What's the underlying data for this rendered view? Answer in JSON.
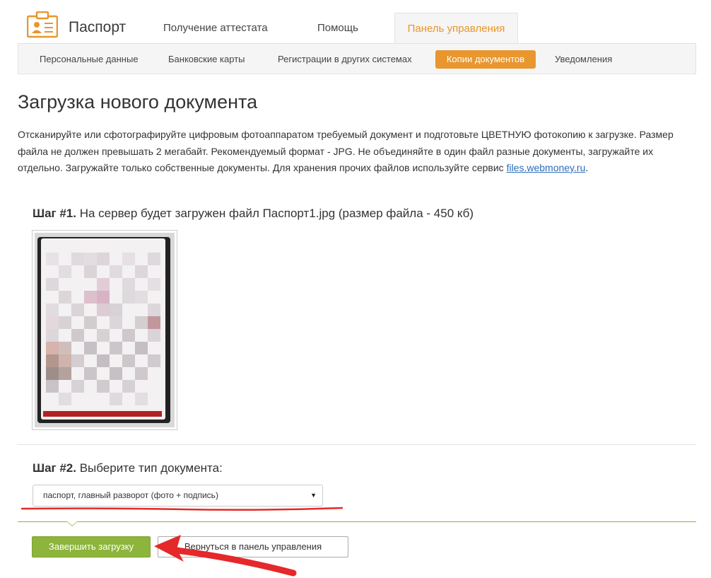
{
  "header": {
    "brand": "Паспорт",
    "tabs": [
      {
        "label": "Получение аттестата"
      },
      {
        "label": "Помощь"
      },
      {
        "label": "Панель управления",
        "active": true
      }
    ]
  },
  "subnav": {
    "items": [
      {
        "label": "Персональные данные"
      },
      {
        "label": "Банковские карты"
      },
      {
        "label": "Регистрации в других системах"
      },
      {
        "label": "Копии документов",
        "active": true
      },
      {
        "label": "Уведомления"
      }
    ]
  },
  "main": {
    "title": "Загрузка нового документа",
    "description": "Отсканируйте или сфотографируйте цифровым фотоаппаратом требуемый документ и подготовьте ЦВЕТНУЮ фотокопию к загрузке. Размер файла не должен превышать 2 мегабайт. Рекомендуемый формат - JPG. Не объединяйте в один файл разные документы, загружайте их отдельно. Загружайте только собственные документы. Для хранения прочих файлов используйте сервис ",
    "description_link": "files.webmoney.ru",
    "description_end": ".",
    "step1": {
      "prefix": "Шаг #1.",
      "text": " На сервер будет загружен файл Паспорт1.jpg (размер файла - 450 кб)"
    },
    "step2": {
      "prefix": "Шаг #2.",
      "text": " Выберите тип документа:"
    },
    "doc_type_select": {
      "selected": "паспорт, главный разворот (фото + подпись)"
    },
    "buttons": {
      "finish": "Завершить загрузку",
      "back": "Вернуться в панель управления"
    }
  },
  "colors": {
    "accent_orange": "#e8962d",
    "accent_green": "#8db53b",
    "annotation_red": "#e5282a",
    "link": "#2a6ebb"
  },
  "icons": {
    "logo": "id-card-icon",
    "select_arrow": "triangle-down-icon"
  }
}
